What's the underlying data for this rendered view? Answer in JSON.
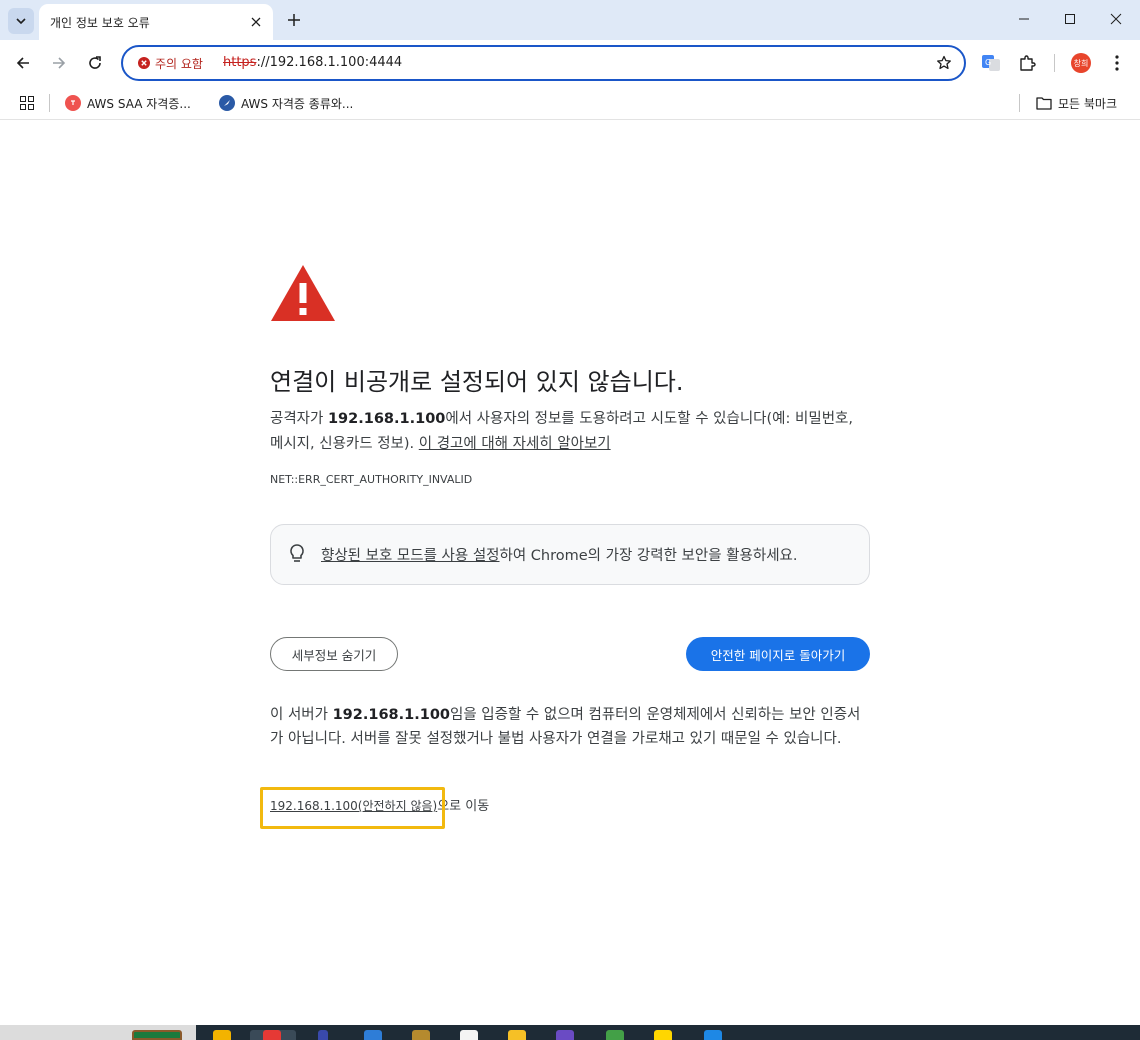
{
  "browser": {
    "tab_title": "개인 정보 보호 오류",
    "address": {
      "security_label": "주의 요함",
      "url_scheme": "https",
      "url_rest": "://192.168.1.100:4444"
    },
    "profile_initials": "창희",
    "bookmarks": [
      {
        "label": "AWS SAA 자격증...",
        "icon": "red-circle-favicon"
      },
      {
        "label": "AWS 자격증 종류와...",
        "icon": "blue-compass-favicon"
      }
    ],
    "all_bookmarks_label": "모든 북마크"
  },
  "interstitial": {
    "heading": "연결이 비공개로 설정되어 있지 않습니다.",
    "body": {
      "prefix": "공격자가 ",
      "host": "192.168.1.100",
      "suffix": "에서 사용자의 정보를 도용하려고 시도할 수 있습니다(예: 비밀번호, 메시지, 신용카드 정보). ",
      "learn_more_link": "이 경고에 대해 자세히 알아보기"
    },
    "error_code": "NET::ERR_CERT_AUTHORITY_INVALID",
    "enhanced_protection": {
      "link": "향상된 보호 모드를 사용 설정",
      "suffix": "하여 Chrome의 가장 강력한 보안을 활용하세요."
    },
    "hide_details_button": "세부정보 숨기기",
    "back_to_safety_button": "안전한 페이지로 돌아가기",
    "details": {
      "prefix": "이 서버가 ",
      "host": "192.168.1.100",
      "suffix": "임을 입증할 수 없으며 컴퓨터의 운영체제에서 신뢰하는 보안 인증서가 아닙니다. 서버를 잘못 설정했거나 불법 사용자가 연결을 가로채고 있기 때문일 수 있습니다."
    },
    "proceed": {
      "link": "192.168.1.100(안전하지 않음)",
      "suffix": "으로 이동"
    }
  },
  "colors": {
    "accent": "#1a73e8",
    "warning_red": "#d93025",
    "annotation_highlight": "#f2b90f"
  }
}
